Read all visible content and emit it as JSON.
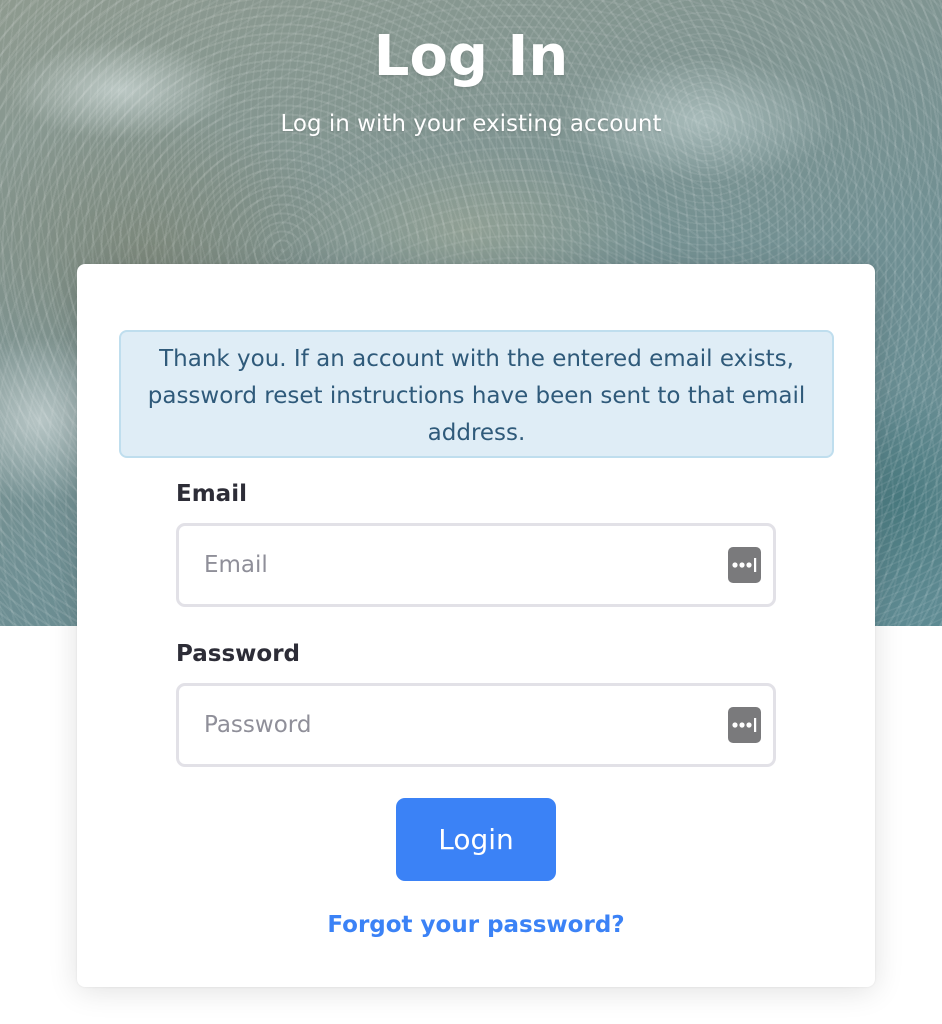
{
  "header": {
    "title": "Log In",
    "subtitle": "Log in with your existing account"
  },
  "alert": {
    "message": "Thank you. If an account with the entered email exists, password reset instructions have been sent to that email address."
  },
  "form": {
    "email": {
      "label": "Email",
      "placeholder": "Email",
      "value": ""
    },
    "password": {
      "label": "Password",
      "placeholder": "Password",
      "value": ""
    },
    "submit_label": "Login",
    "forgot_link": "Forgot your password?"
  },
  "icons": {
    "password_manager": "password-manager-icon"
  },
  "colors": {
    "primary": "#3b82f6",
    "alert_bg": "#dfedf6",
    "alert_border": "#bfdeee",
    "alert_text": "#2f5a7a",
    "label_text": "#2d2d37"
  }
}
